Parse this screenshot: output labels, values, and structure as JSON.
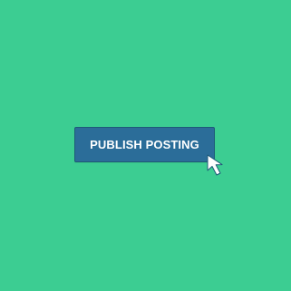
{
  "colors": {
    "background": "#3ccd92",
    "button": "#2b6d99",
    "button_border": "#1e5a78",
    "button_text": "#ffffff",
    "cursor_fill": "#ffffff",
    "cursor_stroke": "#1e5a78"
  },
  "button": {
    "label": "PUBLISH POSTING"
  },
  "cursor": {
    "icon": "arrow-cursor-icon"
  }
}
